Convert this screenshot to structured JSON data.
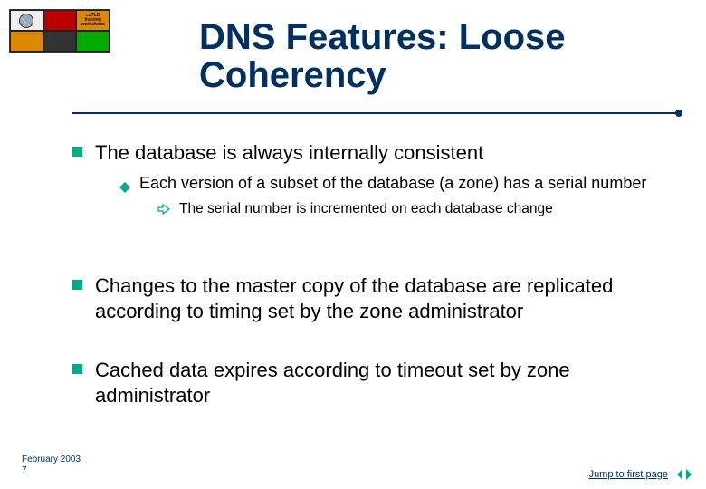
{
  "logo_label": "ccTLD training workshops",
  "title": "DNS Features: Loose Coherency",
  "bullets": [
    {
      "text": "The database is always internally consistent",
      "sub": [
        {
          "text": "Each version of a subset of the database (a zone) has a serial number",
          "sub": [
            {
              "text": "The serial number is incremented on each database change"
            }
          ]
        }
      ]
    },
    {
      "text": "Changes to the master copy of the database are replicated according to timing set by the zone administrator"
    },
    {
      "text": "Cached data expires according to timeout set by zone administrator"
    }
  ],
  "footer": {
    "date": "February 2003",
    "page": "7",
    "jump_label": "Jump to first page"
  }
}
